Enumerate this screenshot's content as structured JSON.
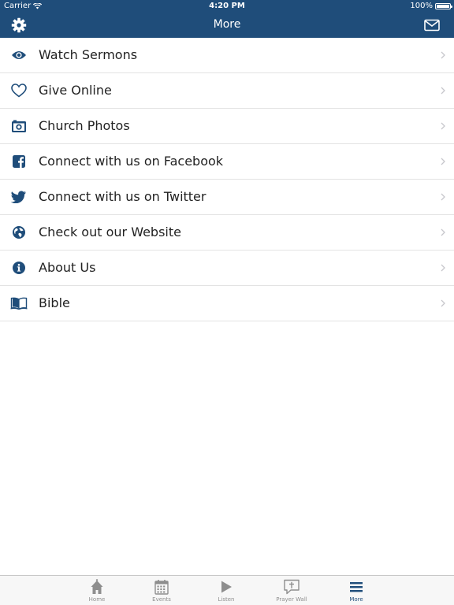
{
  "status_bar": {
    "carrier": "Carrier",
    "time": "4:20 PM",
    "battery": "100%",
    "battery_level": 1.0
  },
  "nav": {
    "title": "More",
    "left_icon": "gear-icon",
    "right_icon": "mail-icon"
  },
  "menu": {
    "items": [
      {
        "label": "Watch Sermons",
        "icon": "eye-icon"
      },
      {
        "label": "Give Online",
        "icon": "heart-icon"
      },
      {
        "label": "Church Photos",
        "icon": "camera-icon"
      },
      {
        "label": "Connect with us on Facebook",
        "icon": "facebook-icon"
      },
      {
        "label": "Connect with us on Twitter",
        "icon": "twitter-icon"
      },
      {
        "label": "Check out our Website",
        "icon": "globe-icon"
      },
      {
        "label": "About Us",
        "icon": "info-icon"
      },
      {
        "label": "Bible",
        "icon": "book-icon"
      }
    ]
  },
  "tabs": [
    {
      "label": "Home",
      "icon": "home-icon"
    },
    {
      "label": "Events",
      "icon": "calendar-icon"
    },
    {
      "label": "Listen",
      "icon": "play-icon"
    },
    {
      "label": "Prayer Wall",
      "icon": "prayer-icon"
    },
    {
      "label": "More",
      "icon": "menu-icon",
      "active": true
    }
  ],
  "colors": {
    "primary": "#1f4d7a",
    "tab_inactive": "#8e8e8e",
    "separator": "#e3e3e3",
    "chevron": "#c7c7cc"
  }
}
